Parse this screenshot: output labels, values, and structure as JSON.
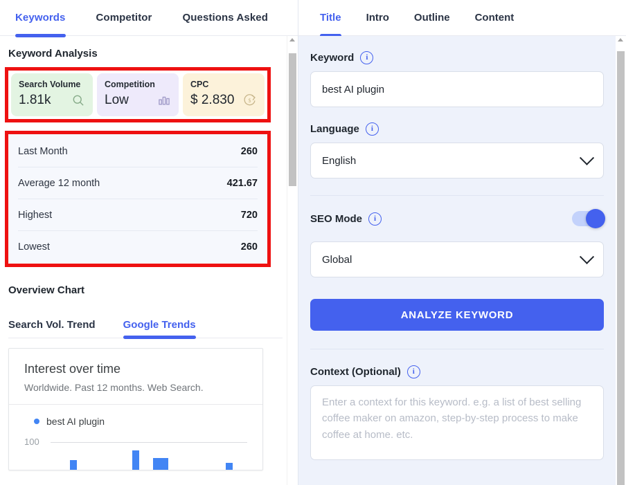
{
  "left": {
    "tabs": [
      {
        "label": "Keywords",
        "active": true
      },
      {
        "label": "Competitor",
        "active": false
      },
      {
        "label": "Questions Asked",
        "active": false
      }
    ],
    "section_title": "Keyword Analysis",
    "metrics": [
      {
        "label": "Search Volume",
        "value": "1.81k",
        "icon": "search-icon",
        "bg": "#e3f4e2"
      },
      {
        "label": "Competition",
        "value": "Low",
        "icon": "bar-chart-icon",
        "bg": "#eeeafb"
      },
      {
        "label": "CPC",
        "value": "$ 2.830",
        "icon": "dollar-refresh-icon",
        "bg": "#fcf2da"
      }
    ],
    "stats": [
      {
        "label": "Last Month",
        "value": "260"
      },
      {
        "label": "Average 12 month",
        "value": "421.67"
      },
      {
        "label": "Highest",
        "value": "720"
      },
      {
        "label": "Lowest",
        "value": "260"
      }
    ],
    "overview_title": "Overview Chart",
    "chart_tabs": [
      {
        "label": "Search Vol. Trend",
        "active": false
      },
      {
        "label": "Google Trends",
        "active": true
      }
    ],
    "trend_card": {
      "title": "Interest over time",
      "subtitle": "Worldwide. Past 12 months. Web Search.",
      "legend": "best AI plugin",
      "axis_max_label": "100"
    },
    "highlight_color": "#ee1111"
  },
  "right": {
    "tabs": [
      {
        "label": "Title",
        "active": true
      },
      {
        "label": "Intro",
        "active": false
      },
      {
        "label": "Outline",
        "active": false
      },
      {
        "label": "Content",
        "active": false
      }
    ],
    "keyword": {
      "label": "Keyword",
      "value": "best AI plugin",
      "info": "i"
    },
    "language": {
      "label": "Language",
      "value": "English",
      "info": "i"
    },
    "seo_mode": {
      "label": "SEO Mode",
      "info": "i",
      "enabled": true,
      "scope_value": "Global"
    },
    "analyze_button": "ANALYZE KEYWORD",
    "context": {
      "label": "Context (Optional)",
      "info": "i",
      "placeholder": "Enter a context for this keyword. e.g. a list of best selling coffee maker on amazon, step-by-step process to make coffee at home. etc."
    },
    "accent_color": "#4461ee",
    "panel_bg": "#eef2fb"
  },
  "chart_data": {
    "type": "bar",
    "title": "Interest over time",
    "subtitle": "Worldwide. Past 12 months. Web Search.",
    "series": [
      {
        "name": "best AI plugin",
        "values": [
          18,
          0,
          0,
          0,
          100,
          0,
          55,
          0,
          0,
          0,
          0,
          22
        ]
      }
    ],
    "x": [
      "1",
      "2",
      "3",
      "4",
      "5",
      "6",
      "7",
      "8",
      "9",
      "10",
      "11",
      "12"
    ],
    "ylim": [
      0,
      100
    ],
    "ytick_labels": [
      "100"
    ],
    "xlabel": "",
    "ylabel": "",
    "grid": true,
    "legend_position": "top-left",
    "color": "#4285f4"
  }
}
